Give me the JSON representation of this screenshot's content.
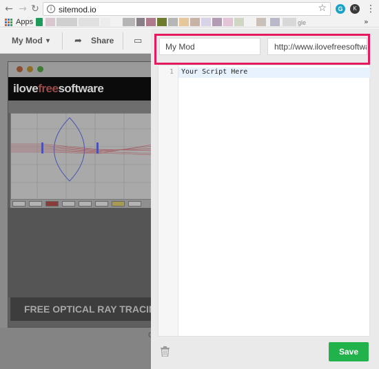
{
  "browser": {
    "url": "sitemod.io",
    "back_icon": "←",
    "forward_icon": "→",
    "reload_icon": "↻",
    "star_icon": "☆",
    "menu_icon": "⋮",
    "ext_grammarly": "G",
    "ext_profile": "K"
  },
  "bookmarks": {
    "apps_label": "Apps",
    "partial_item": "gle",
    "overflow_icon": "»"
  },
  "toolbar": {
    "mod_select_label": "My Mod",
    "mod_select_caret": "▾",
    "share_label": "Share",
    "share_icon": "➦",
    "device_icon": "▭"
  },
  "preview": {
    "logo_pre": "ilove",
    "logo_free": "free",
    "logo_post": "software",
    "caption": "FREE OPTICAL RAY TRACING SO",
    "footer_partial": "C"
  },
  "editor": {
    "mod_name_value": "My Mod",
    "url_value": "http://www.ilovefreesoftware",
    "line_number": "1",
    "script_text": "Your Script Here",
    "save_label": "Save"
  },
  "colors": {
    "highlight": "#e5195c",
    "save_button": "#21b24b",
    "active_line": "#e8f2fe"
  }
}
